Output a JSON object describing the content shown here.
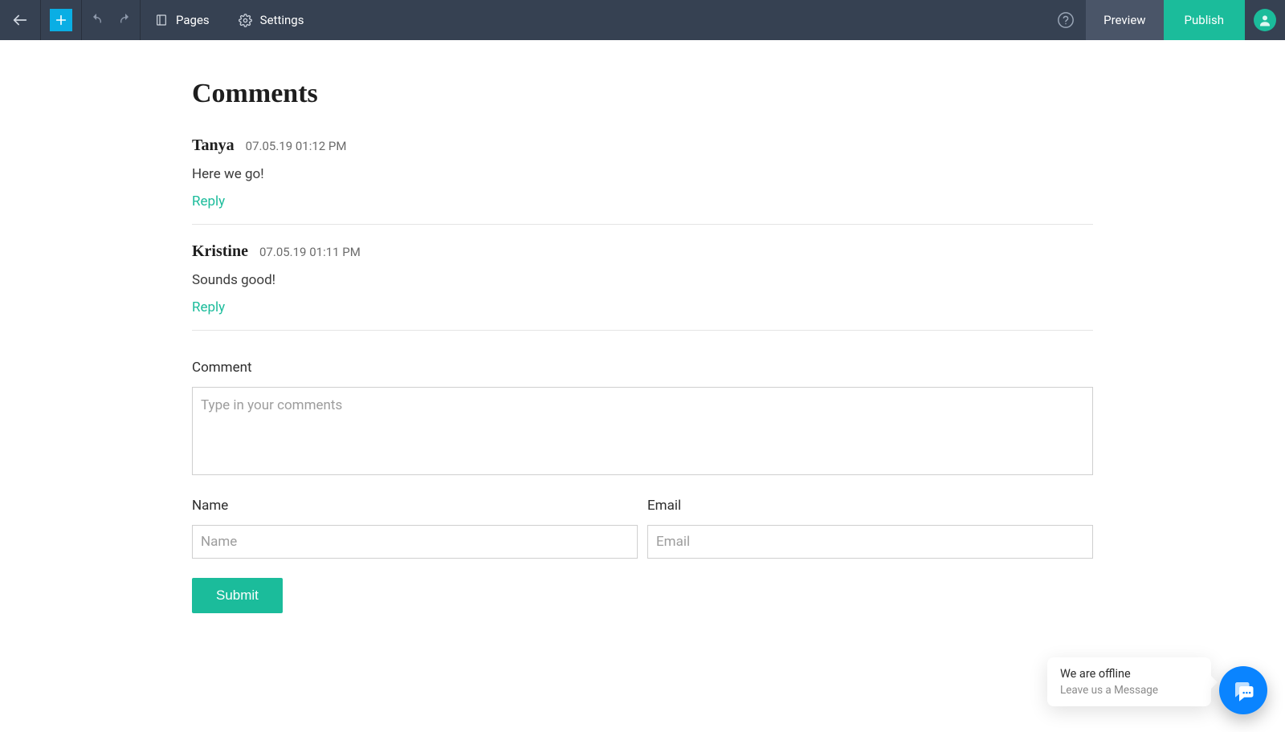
{
  "topbar": {
    "pages_label": "Pages",
    "settings_label": "Settings",
    "preview_label": "Preview",
    "publish_label": "Publish"
  },
  "section_title": "Comments",
  "comments": [
    {
      "author": "Tanya",
      "date": "07.05.19 01:12 PM",
      "body": "Here we go!",
      "reply_label": "Reply"
    },
    {
      "author": "Kristine",
      "date": "07.05.19 01:11 PM",
      "body": "Sounds good!",
      "reply_label": "Reply"
    }
  ],
  "form": {
    "comment_label": "Comment",
    "comment_placeholder": "Type in your comments",
    "name_label": "Name",
    "name_placeholder": "Name",
    "email_label": "Email",
    "email_placeholder": "Email",
    "submit_label": "Submit"
  },
  "chat": {
    "title": "We are offline",
    "subtitle": "Leave us a Message"
  }
}
